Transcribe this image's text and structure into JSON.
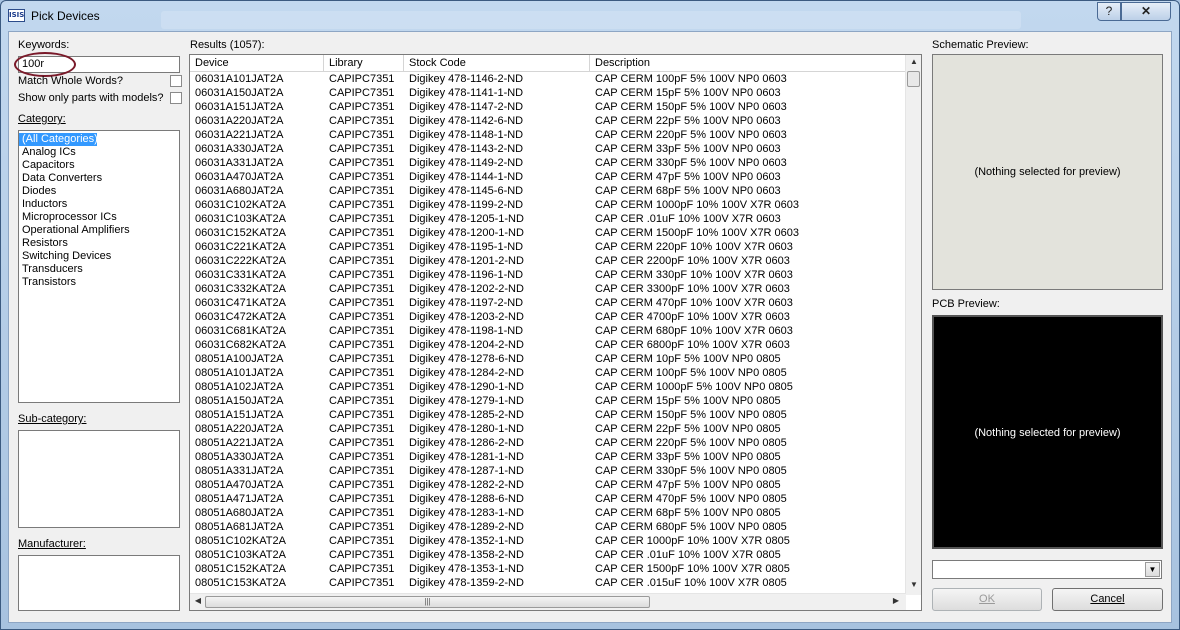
{
  "window": {
    "title": "Pick Devices",
    "app_icon_text": "ISIS",
    "help_label": "?",
    "close_label": "✕"
  },
  "left": {
    "keywords_label": "Keywords:",
    "keywords_value": "100r",
    "match_whole_words_label": "Match Whole Words?",
    "show_models_label": "Show only parts with models?",
    "category_label": "Category:",
    "categories": [
      "(All Categories)",
      "Analog ICs",
      "Capacitors",
      "Data Converters",
      "Diodes",
      "Inductors",
      "Microprocessor ICs",
      "Operational Amplifiers",
      "Resistors",
      "Switching Devices",
      "Transducers",
      "Transistors"
    ],
    "subcategory_label": "Sub-category:",
    "manufacturer_label": "Manufacturer:"
  },
  "results": {
    "label": "Results (1057):",
    "columns": [
      "Device",
      "Library",
      "Stock Code",
      "Description"
    ],
    "rows": [
      [
        "06031A101JAT2A",
        "CAPIPC7351",
        "Digikey 478-1146-2-ND",
        "CAP CERM 100pF 5% 100V NP0 0603"
      ],
      [
        "06031A150JAT2A",
        "CAPIPC7351",
        "Digikey 478-1141-1-ND",
        "CAP CERM 15pF 5% 100V NP0 0603"
      ],
      [
        "06031A151JAT2A",
        "CAPIPC7351",
        "Digikey 478-1147-2-ND",
        "CAP CERM 150pF 5% 100V NP0 0603"
      ],
      [
        "06031A220JAT2A",
        "CAPIPC7351",
        "Digikey 478-1142-6-ND",
        "CAP CERM 22pF 5% 100V NP0 0603"
      ],
      [
        "06031A221JAT2A",
        "CAPIPC7351",
        "Digikey 478-1148-1-ND",
        "CAP CERM 220pF 5% 100V NP0 0603"
      ],
      [
        "06031A330JAT2A",
        "CAPIPC7351",
        "Digikey 478-1143-2-ND",
        "CAP CERM 33pF 5% 100V NP0 0603"
      ],
      [
        "06031A331JAT2A",
        "CAPIPC7351",
        "Digikey 478-1149-2-ND",
        "CAP CERM 330pF 5% 100V NP0 0603"
      ],
      [
        "06031A470JAT2A",
        "CAPIPC7351",
        "Digikey 478-1144-1-ND",
        "CAP CERM 47pF 5% 100V NP0 0603"
      ],
      [
        "06031A680JAT2A",
        "CAPIPC7351",
        "Digikey 478-1145-6-ND",
        "CAP CERM 68pF 5% 100V NP0 0603"
      ],
      [
        "06031C102KAT2A",
        "CAPIPC7351",
        "Digikey 478-1199-2-ND",
        "CAP CERM 1000pF 10% 100V X7R 0603"
      ],
      [
        "06031C103KAT2A",
        "CAPIPC7351",
        "Digikey 478-1205-1-ND",
        "CAP CER .01uF 10% 100V X7R 0603"
      ],
      [
        "06031C152KAT2A",
        "CAPIPC7351",
        "Digikey 478-1200-1-ND",
        "CAP CERM 1500pF 10% 100V X7R 0603"
      ],
      [
        "06031C221KAT2A",
        "CAPIPC7351",
        "Digikey 478-1195-1-ND",
        "CAP CERM 220pF 10% 100V X7R 0603"
      ],
      [
        "06031C222KAT2A",
        "CAPIPC7351",
        "Digikey 478-1201-2-ND",
        "CAP CER 2200pF 10% 100V X7R 0603"
      ],
      [
        "06031C331KAT2A",
        "CAPIPC7351",
        "Digikey 478-1196-1-ND",
        "CAP CERM 330pF 10% 100V X7R 0603"
      ],
      [
        "06031C332KAT2A",
        "CAPIPC7351",
        "Digikey 478-1202-2-ND",
        "CAP CER 3300pF 10% 100V X7R 0603"
      ],
      [
        "06031C471KAT2A",
        "CAPIPC7351",
        "Digikey 478-1197-2-ND",
        "CAP CERM 470pF 10% 100V X7R 0603"
      ],
      [
        "06031C472KAT2A",
        "CAPIPC7351",
        "Digikey 478-1203-2-ND",
        "CAP CER 4700pF 10% 100V X7R 0603"
      ],
      [
        "06031C681KAT2A",
        "CAPIPC7351",
        "Digikey 478-1198-1-ND",
        "CAP CERM 680pF 10% 100V X7R 0603"
      ],
      [
        "06031C682KAT2A",
        "CAPIPC7351",
        "Digikey 478-1204-2-ND",
        "CAP CER 6800pF 10% 100V X7R 0603"
      ],
      [
        "08051A100JAT2A",
        "CAPIPC7351",
        "Digikey 478-1278-6-ND",
        "CAP CERM 10pF 5% 100V NP0 0805"
      ],
      [
        "08051A101JAT2A",
        "CAPIPC7351",
        "Digikey 478-1284-2-ND",
        "CAP CERM 100pF 5% 100V NP0 0805"
      ],
      [
        "08051A102JAT2A",
        "CAPIPC7351",
        "Digikey 478-1290-1-ND",
        "CAP CERM 1000pF 5% 100V NP0 0805"
      ],
      [
        "08051A150JAT2A",
        "CAPIPC7351",
        "Digikey 478-1279-1-ND",
        "CAP CERM 15pF 5% 100V NP0 0805"
      ],
      [
        "08051A151JAT2A",
        "CAPIPC7351",
        "Digikey 478-1285-2-ND",
        "CAP CERM 150pF 5% 100V NP0 0805"
      ],
      [
        "08051A220JAT2A",
        "CAPIPC7351",
        "Digikey 478-1280-1-ND",
        "CAP CERM 22pF 5% 100V NP0 0805"
      ],
      [
        "08051A221JAT2A",
        "CAPIPC7351",
        "Digikey 478-1286-2-ND",
        "CAP CERM 220pF 5% 100V NP0 0805"
      ],
      [
        "08051A330JAT2A",
        "CAPIPC7351",
        "Digikey 478-1281-1-ND",
        "CAP CERM 33pF 5% 100V NP0 0805"
      ],
      [
        "08051A331JAT2A",
        "CAPIPC7351",
        "Digikey 478-1287-1-ND",
        "CAP CERM 330pF 5% 100V NP0 0805"
      ],
      [
        "08051A470JAT2A",
        "CAPIPC7351",
        "Digikey 478-1282-2-ND",
        "CAP CERM 47pF 5% 100V NP0 0805"
      ],
      [
        "08051A471JAT2A",
        "CAPIPC7351",
        "Digikey 478-1288-6-ND",
        "CAP CERM 470pF 5% 100V NP0 0805"
      ],
      [
        "08051A680JAT2A",
        "CAPIPC7351",
        "Digikey 478-1283-1-ND",
        "CAP CERM 68pF 5% 100V NP0 0805"
      ],
      [
        "08051A681JAT2A",
        "CAPIPC7351",
        "Digikey 478-1289-2-ND",
        "CAP CERM 680pF 5% 100V NP0 0805"
      ],
      [
        "08051C102KAT2A",
        "CAPIPC7351",
        "Digikey 478-1352-1-ND",
        "CAP CER 1000pF 10% 100V X7R 0805"
      ],
      [
        "08051C103KAT2A",
        "CAPIPC7351",
        "Digikey 478-1358-2-ND",
        "CAP CER .01uF 10% 100V X7R 0805"
      ],
      [
        "08051C152KAT2A",
        "CAPIPC7351",
        "Digikey 478-1353-1-ND",
        "CAP CER 1500pF 10% 100V X7R 0805"
      ],
      [
        "08051C153KAT2A",
        "CAPIPC7351",
        "Digikey 478-1359-2-ND",
        "CAP CER .015uF 10% 100V X7R 0805"
      ]
    ]
  },
  "right": {
    "schematic_label": "Schematic Preview:",
    "schematic_empty": "(Nothing selected for preview)",
    "pcb_label": "PCB Preview:",
    "pcb_empty": "(Nothing selected for preview)",
    "ok_label": "OK",
    "cancel_label": "Cancel"
  },
  "colors": {
    "selection": "#3399ff",
    "highlight_oval": "#7a1a2a",
    "schematic_bg": "#e3e3dc",
    "pcb_bg": "#000000"
  }
}
